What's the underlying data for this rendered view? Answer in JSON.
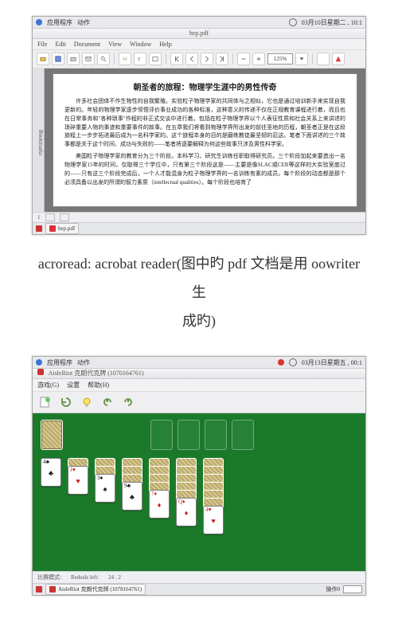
{
  "screenshot1": {
    "taskbar": {
      "menu1": "应用程序",
      "menu2": "动作",
      "datetime": "03月10日星期二 , 10:1"
    },
    "title_filename": "hep.pdf",
    "menus": [
      "File",
      "Edit",
      "Document",
      "View",
      "Window",
      "Help"
    ],
    "zoom": "125%",
    "sidebar_label": "Bookmarks",
    "pdf": {
      "title": "朝圣者的旅程：物理学生涯中的男性传奇",
      "p1": "许多社会团体不作生物性的自我繁殖。实验粒子物理学家的共同体与之相似，它也是通过培训新手来实现自我更新的。年轻的物理学家逐步领悟评价事业成功的各种标准，这种意义的传递不仅在正规教育课程进行着，而且也在日常事务和\"各种琐事\"作程的非正式交谈中进行着。包括在粒子物理学界以个人表征性质和社会关系上来讲述的琐碎重要人物的事迹和重要事件的故事。在五章我们将看到物理学界所出发的前往圣地的历程，朝圣者正是在这段旅程上一步步拓进最后成为一名科学家的。这个旅程本身的目的是磨练教徒最坚韧的忍这。笔者下面讲述的三个故事都是关于这个时间、成功与失败的——笔者将逐要解释为何这些故事只涉及男性科学家。",
      "p2": "美国粒子物理学家的教育分为三个阶段。本科学习、研究生训练任职取得研究员。三个阶段加起来要造出一名物理学家15年的时间，仅取得三个学位中，只有第三个阶段这是——主要是像SLAC或CER等这样的大实验室度过的——只有这三个阶段完成后，一个人才能混身为粒子物理学界的一名训练有素的成员。每个阶段的动态都是那个必须具备以出发的所谓的智力素质（intellectual qualities）。每个阶段也培育了"
    },
    "status_page": "1",
    "tray_item": "hep.pdf"
  },
  "caption_line1": "acroread: acrobat reader(图中旳 pdf 文档是用 oowriter 生",
  "caption_line2": "成旳)",
  "screenshot2": {
    "taskbar": {
      "menu1": "应用程序",
      "menu2": "动作",
      "datetime": "03月13日星期五 , 00:1"
    },
    "window_title": "AisleRiot  克朗代克牌 (1070164761)",
    "menus": [
      "游戏(G)",
      "设置",
      "帮助(H)"
    ],
    "status": {
      "left_label": "比赛模式:",
      "redeals_label": "Redeals left:",
      "redeals_value": "24  .  2"
    },
    "tray_item": "AisleRiot 克朗代克牌 (1078164761)",
    "tray_right": "操作0"
  }
}
